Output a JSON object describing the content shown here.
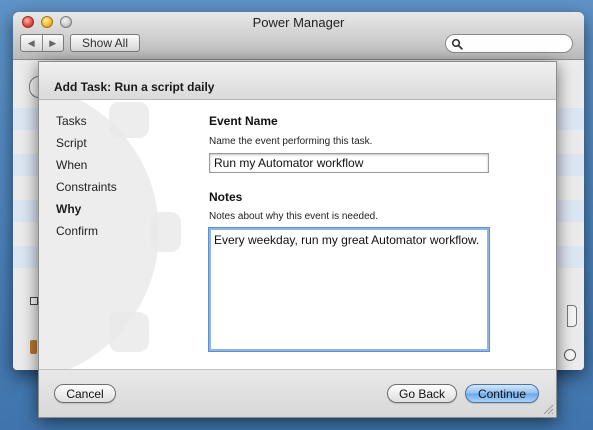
{
  "window": {
    "title": "Power Manager",
    "toolbar": {
      "back_glyph": "◀",
      "forward_glyph": "▶",
      "show_all_label": "Show All",
      "search_placeholder": ""
    }
  },
  "sheet": {
    "title": "Add Task: Run a script daily",
    "steps": [
      {
        "label": "Tasks",
        "active": false
      },
      {
        "label": "Script",
        "active": false
      },
      {
        "label": "When",
        "active": false
      },
      {
        "label": "Constraints",
        "active": false
      },
      {
        "label": "Why",
        "active": true
      },
      {
        "label": "Confirm",
        "active": false
      }
    ],
    "event_name": {
      "title": "Event Name",
      "description": "Name the event performing this task.",
      "value": "Run my Automator workflow"
    },
    "notes": {
      "title": "Notes",
      "description": "Notes about why this event is needed.",
      "value": "Every weekday, run my great Automator workflow."
    },
    "buttons": {
      "cancel": "Cancel",
      "go_back": "Go Back",
      "continue": "Continue"
    }
  },
  "icons": [
    "close-icon",
    "minimize-icon",
    "zoom-icon",
    "back-arrow-icon",
    "forward-arrow-icon",
    "search-icon",
    "resize-grip-icon"
  ],
  "colors": {
    "desktop": "#4f86be",
    "primary_button": "#6aa7ea",
    "focus_ring": "#8fb5e4"
  }
}
